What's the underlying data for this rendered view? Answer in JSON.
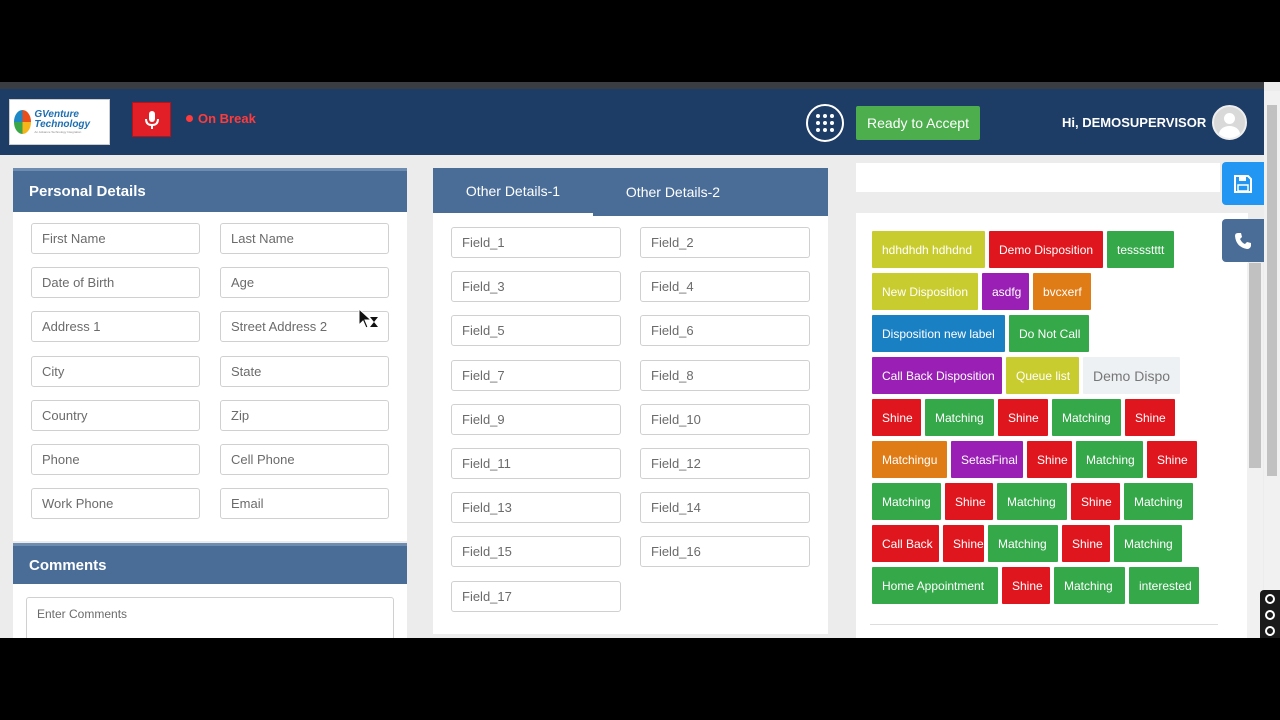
{
  "header": {
    "logo": {
      "name": "GVenture Technology",
      "sub": "An Advance Technology Integration"
    },
    "status_text": "On Break",
    "ready_button": "Ready to Accept",
    "greeting": "Hi, DEMOSUPERVISOR",
    "colors": {
      "bar": "#1e3d66",
      "mic": "#e21f26",
      "ready": "#4cae4c",
      "status": "#ff3b3b"
    }
  },
  "personal": {
    "title": "Personal Details",
    "fields": [
      "First Name",
      "Last Name",
      "Date of Birth",
      "Age",
      "Address 1",
      "Street Address 2",
      "City",
      "State",
      "Country",
      "Zip",
      "Phone",
      "Cell Phone",
      "Work Phone",
      "Email"
    ]
  },
  "comments": {
    "title": "Comments",
    "placeholder": "Enter Comments"
  },
  "other": {
    "tabs": [
      "Other Details-1",
      "Other Details-2"
    ],
    "fields": [
      "Field_1",
      "Field_2",
      "Field_3",
      "Field_4",
      "Field_5",
      "Field_6",
      "Field_7",
      "Field_8",
      "Field_9",
      "Field_10",
      "Field_11",
      "Field_12",
      "Field_13",
      "Field_14",
      "Field_15",
      "Field_16",
      "Field_17"
    ]
  },
  "dispositions": [
    {
      "label": "hdhdhdh hdhdnd",
      "color": "#c9cc2e"
    },
    {
      "label": "Demo Disposition",
      "color": "#e0161e"
    },
    {
      "label": "tesssstttt",
      "color": "#35a84a"
    },
    {
      "label": "New Disposition",
      "color": "#c9cc2e"
    },
    {
      "label": "asdfg",
      "color": "#9a1fb4"
    },
    {
      "label": "bvcxerf",
      "color": "#e07c16"
    },
    {
      "label": "Disposition new label",
      "color": "#1a80c4"
    },
    {
      "label": "Do Not Call",
      "color": "#35a84a"
    },
    {
      "label": "Call Back Disposition",
      "color": "#9a1fb4"
    },
    {
      "label": "Queue list",
      "color": "#c9cc2e"
    },
    {
      "label": "Demo Dispo",
      "color": "#eef1f4"
    },
    {
      "label": "Shine",
      "color": "#e0161e"
    },
    {
      "label": "Matching",
      "color": "#35a84a"
    },
    {
      "label": "Shine",
      "color": "#e0161e"
    },
    {
      "label": "Matching",
      "color": "#35a84a"
    },
    {
      "label": "Shine",
      "color": "#e0161e"
    },
    {
      "label": "Matchingu",
      "color": "#e07c16"
    },
    {
      "label": "SetasFinal",
      "color": "#9a1fb4"
    },
    {
      "label": "Shine",
      "color": "#e0161e"
    },
    {
      "label": "Matching",
      "color": "#35a84a"
    },
    {
      "label": "Shine",
      "color": "#e0161e"
    },
    {
      "label": "Matching",
      "color": "#35a84a"
    },
    {
      "label": "Shine",
      "color": "#e0161e"
    },
    {
      "label": "Matching",
      "color": "#35a84a"
    },
    {
      "label": "Shine",
      "color": "#e0161e"
    },
    {
      "label": "Matching",
      "color": "#35a84a"
    },
    {
      "label": "Call Back",
      "color": "#e0161e"
    },
    {
      "label": "Shine",
      "color": "#e0161e"
    },
    {
      "label": "Matching",
      "color": "#35a84a"
    },
    {
      "label": "Shine",
      "color": "#e0161e"
    },
    {
      "label": "Matching",
      "color": "#35a84a"
    },
    {
      "label": "Home Appointment",
      "color": "#35a84a"
    },
    {
      "label": "Shine",
      "color": "#e0161e"
    },
    {
      "label": "Matching",
      "color": "#35a84a"
    },
    {
      "label": "interested",
      "color": "#35a84a"
    }
  ],
  "icons": {
    "mic": "microphone-icon",
    "dialpad": "dialpad-icon",
    "save": "save-icon",
    "phone": "phone-icon",
    "avatar": "user-avatar"
  }
}
